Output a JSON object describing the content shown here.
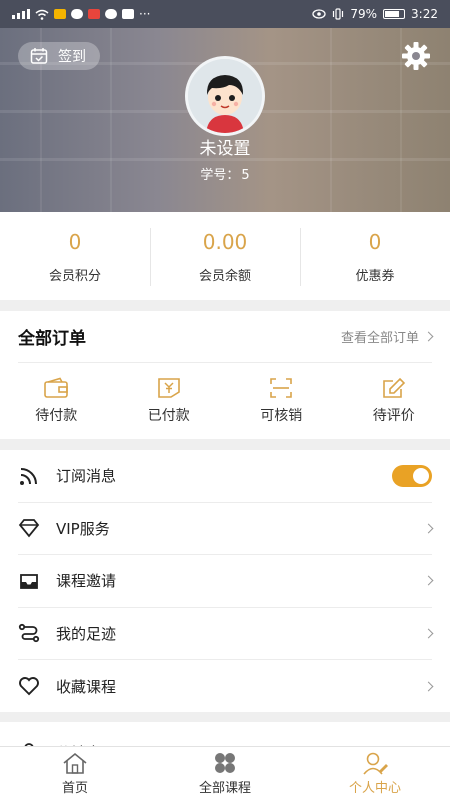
{
  "status_bar": {
    "time": "3:22",
    "battery_text": "79%"
  },
  "header": {
    "checkin_label": "签到",
    "nickname": "未设置",
    "student_no_label": "学号：",
    "student_no_value": "5"
  },
  "stats": [
    {
      "value": "0",
      "label": "会员积分"
    },
    {
      "value": "0.00",
      "label": "会员余额"
    },
    {
      "value": "0",
      "label": "优惠券"
    }
  ],
  "orders": {
    "title": "全部订单",
    "view_all": "查看全部订单",
    "items": [
      {
        "label": "待付款",
        "icon": "wallet-icon"
      },
      {
        "label": "已付款",
        "icon": "paid-yen-icon"
      },
      {
        "label": "可核销",
        "icon": "scan-icon"
      },
      {
        "label": "待评价",
        "icon": "edit-review-icon"
      }
    ]
  },
  "menu": [
    {
      "label": "订阅消息",
      "icon": "rss-icon",
      "toggle_on": true
    },
    {
      "label": "VIP服务",
      "icon": "diamond-icon"
    },
    {
      "label": "课程邀请",
      "icon": "inbox-icon"
    },
    {
      "label": "我的足迹",
      "icon": "route-icon"
    },
    {
      "label": "收藏课程",
      "icon": "heart-icon"
    },
    {
      "label": "分销中心",
      "icon": "user-icon"
    }
  ],
  "tabbar": [
    {
      "label": "首页",
      "icon": "home-icon",
      "active": false
    },
    {
      "label": "全部课程",
      "icon": "grid-icon",
      "active": false
    },
    {
      "label": "个人中心",
      "icon": "profile-icon",
      "active": true
    }
  ],
  "colors": {
    "accent": "#d9a44a",
    "toggle": "#e9a225"
  }
}
